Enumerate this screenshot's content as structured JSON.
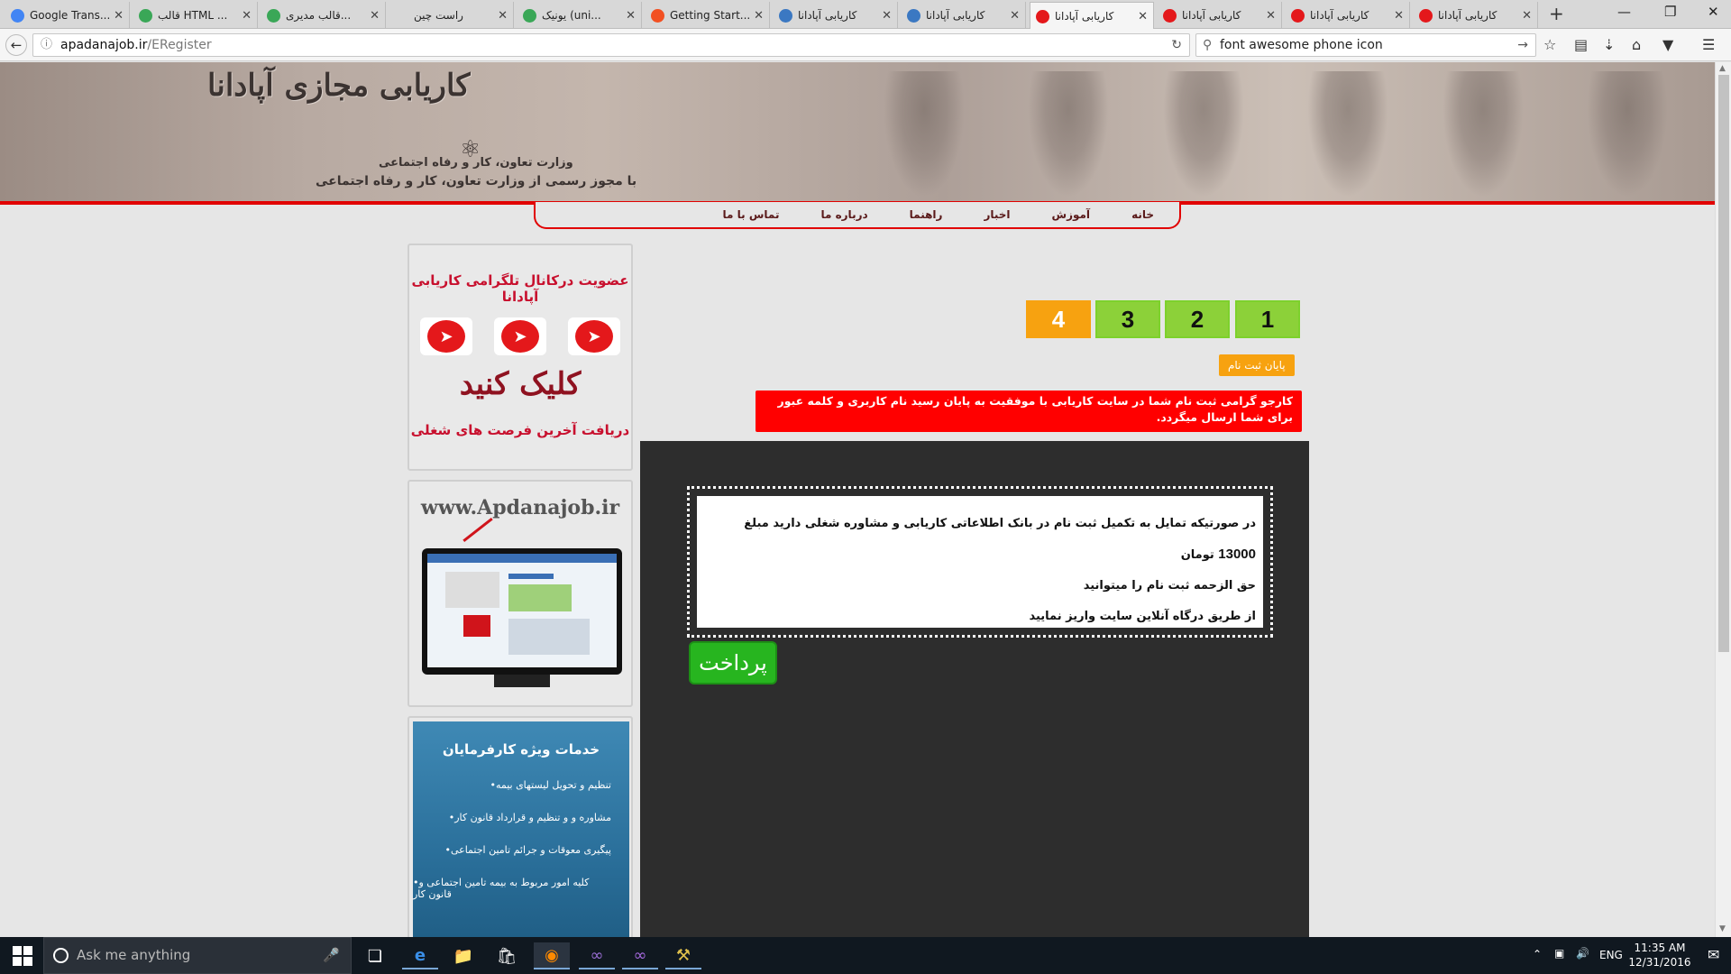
{
  "browser": {
    "tabs": [
      {
        "title": "Google Trans...",
        "fav_color": "#4285f4"
      },
      {
        "title": "قالب HTML ...",
        "fav_color": "#3aa757"
      },
      {
        "title": "قالب مدیری...",
        "fav_color": "#3aa757"
      },
      {
        "title": "راست چین",
        "fav_color": "#d8d8d8"
      },
      {
        "title": "یونیک (uni...",
        "fav_color": "#3aa757"
      },
      {
        "title": "Getting Start...",
        "fav_color": "#f25022"
      },
      {
        "title": "کاریابی آپادانا",
        "fav_color": "#3b78c2"
      },
      {
        "title": "کاریابی آپادانا",
        "fav_color": "#3b78c2"
      },
      {
        "title": "کاریابی آپادانا",
        "fav_color": "#e4181b"
      },
      {
        "title": "کاریابی آپادانا",
        "fav_color": "#e4181b"
      },
      {
        "title": "کاریابی آپادانا",
        "fav_color": "#e4181b"
      },
      {
        "title": "کاریابی آپادانا",
        "fav_color": "#e4181b"
      }
    ],
    "active_tab": 8,
    "url_host": "apadanajob.ir",
    "url_path": "/ERegister",
    "search_value": "font awesome phone icon"
  },
  "site": {
    "banner_title": "کاریابی مجازی آپادانا",
    "ministry": "وزارت تعاون، کار و رفاه اجتماعی",
    "license": "با مجوز رسمی از وزارت تعاون، کار و رفاه اجتماعی",
    "menu": [
      "خانه",
      "آموزش",
      "اخبار",
      "راهنما",
      "درباره ما",
      "تماس با ما"
    ],
    "accent_red": "#e10000"
  },
  "sidebar": {
    "telegram_title": "عضویت درکانال تلگرامی کاریابی آپادانا",
    "telegram_click": "کلیک کنید",
    "telegram_sub": "دریافت آخرین فرصت های شغلی",
    "site_url": "www.Apdanajob.ir",
    "employer_title": "خدمات ویژه کارفرمایان",
    "employer_items": [
      "•تنظیم و تحویل لیستهای بیمه",
      "•مشاوره و و تنظیم و قرارداد قانون کار",
      "•پیگیری معوقات و جرائم تامین اجتماعی",
      "•کلیه امور مربوط به بیمه تامین اجتماعی و قانون کار"
    ]
  },
  "steps": {
    "labels": [
      "1",
      "2",
      "3",
      "4"
    ],
    "active": "4",
    "color_done": "#8cd139",
    "color_active": "#f7a210"
  },
  "registration": {
    "end_badge": "پایان ثبت نام",
    "success_message": "کارجو گرامی ثبت نام شما در سایت کاریابی با موفقیت به پایان رسید نام کاربری و کلمه عبور برای شما ارسال میگردد.",
    "info_line1_prefix": "در صورتیکه تمایل به تکمیل ثبت نام در بانک اطلاعاتی کاریابی و مشاوره شغلی دارید مبلغ",
    "info_amount": "13000",
    "info_line1_suffix": "تومان",
    "info_line2": "حق الزحمه ثبت نام را میتوانید",
    "info_line3": "از طریق درگاه آنلاین سایت واریز نمایید",
    "pay_button": "پرداخت"
  },
  "taskbar": {
    "search_placeholder": "Ask me anything",
    "lang": "ENG",
    "time": "11:35 AM",
    "date": "12/31/2016"
  }
}
